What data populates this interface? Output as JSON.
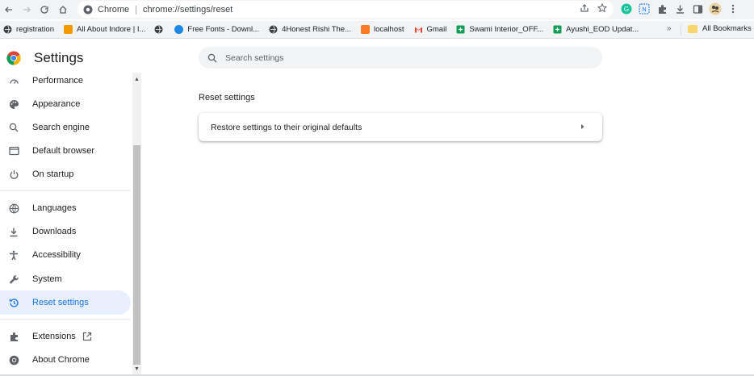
{
  "toolbar": {
    "omnibox_chip": "Chrome",
    "omnibox_url": "chrome://settings/reset"
  },
  "bookmarks": {
    "items": [
      {
        "label": "registration",
        "icon": "globe-icon",
        "color": "#3c4043"
      },
      {
        "label": "All About Indore | I...",
        "icon": "orange-site-icon",
        "color": "#f29900"
      },
      {
        "label": "",
        "icon": "globe-icon",
        "color": "#3c4043"
      },
      {
        "label": "Free Fonts - Downl...",
        "icon": "blue-site-icon",
        "color": "#1e88e5"
      },
      {
        "label": "4Honest Rishi The...",
        "icon": "globe-icon",
        "color": "#3c4043"
      },
      {
        "label": "localhost",
        "icon": "xampp-icon",
        "color": "#fb7a24"
      },
      {
        "label": "Gmail",
        "icon": "gmail-icon",
        "color": "#ea4335"
      },
      {
        "label": "Swami Interior_OFF...",
        "icon": "sheets-icon",
        "color": "#0f9d58"
      },
      {
        "label": "Ayushi_EOD Updat...",
        "icon": "sheets-icon",
        "color": "#0f9d58"
      }
    ],
    "all_bookmarks": "All Bookmarks"
  },
  "settings": {
    "title": "Settings",
    "search_placeholder": "Search settings"
  },
  "sidebar": {
    "items": [
      {
        "label": "Performance",
        "icon": "performance-icon"
      },
      {
        "label": "Appearance",
        "icon": "palette-icon"
      },
      {
        "label": "Search engine",
        "icon": "search-icon"
      },
      {
        "label": "Default browser",
        "icon": "browser-icon"
      },
      {
        "label": "On startup",
        "icon": "power-icon"
      },
      {
        "label": "Languages",
        "icon": "globe-icon"
      },
      {
        "label": "Downloads",
        "icon": "download-icon"
      },
      {
        "label": "Accessibility",
        "icon": "accessibility-icon"
      },
      {
        "label": "System",
        "icon": "wrench-icon"
      },
      {
        "label": "Reset settings",
        "icon": "history-icon",
        "active": true
      },
      {
        "label": "Extensions",
        "icon": "puzzle-icon"
      },
      {
        "label": "About Chrome",
        "icon": "chrome-icon"
      }
    ]
  },
  "main": {
    "section_title": "Reset settings",
    "restore_label": "Restore settings to their original defaults"
  },
  "colors": {
    "accent": "#1a73e8",
    "active_bg": "#e8f0fe"
  }
}
